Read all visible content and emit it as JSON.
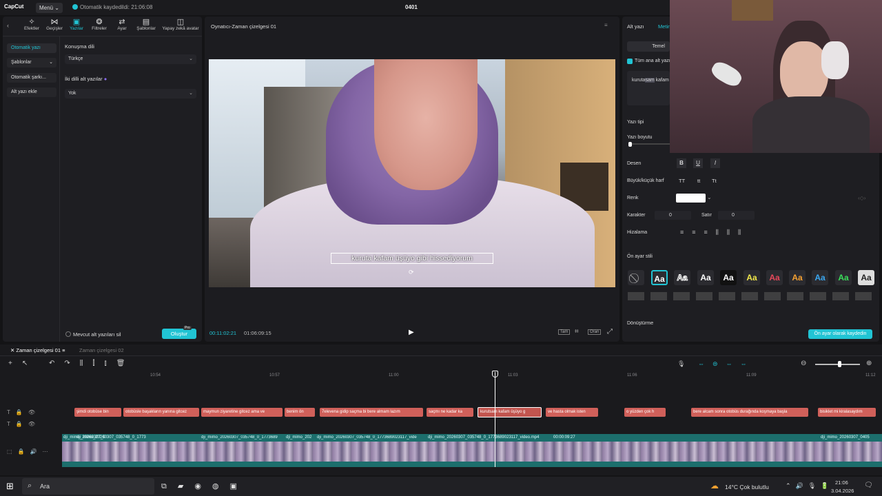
{
  "app": {
    "logo": "CapCut",
    "menu": "Menü",
    "autosave": "Otomatik kaydedildi: 21:06:08",
    "project_title": "0401"
  },
  "toolbar": [
    {
      "label": "Efektler",
      "icon": "effects-icon"
    },
    {
      "label": "Geçişler",
      "icon": "transitions-icon"
    },
    {
      "label": "Yazılar",
      "icon": "text-icon"
    },
    {
      "label": "Filtreler",
      "icon": "filters-icon"
    },
    {
      "label": "Ayar",
      "icon": "adjust-icon"
    },
    {
      "label": "Şablonlar",
      "icon": "templates-icon"
    },
    {
      "label": "Yapay zekâ avatar",
      "icon": "ai-avatar-icon"
    }
  ],
  "sidebar": {
    "items": [
      "Otomatik yazı",
      "Şablonlar",
      "Otomatik şarkı...",
      "Alt yazı ekle"
    ]
  },
  "captions_panel": {
    "speech_language_label": "Konuşma dili",
    "speech_language_value": "Türkçe",
    "bilingual_label": "İki dilli alt yazılar",
    "bilingual_value": "Yok",
    "delete_existing": "Mevcut alt yazıları sil",
    "create_button": "Oluştur",
    "pro_badge": "Pro"
  },
  "player": {
    "title": "Oynatıcı-Zaman çizelgesi 01",
    "subtitle_text": "kuruta kafam üşüyo gibi hissediyorum",
    "current_time": "00:11:02:21",
    "total_time": "01:06:09:15",
    "full_label": "Tam",
    "ratio_label": "Oran"
  },
  "right_panel": {
    "tab_caption": "Alt yazı",
    "tab_text": "Metin",
    "basic_tab": "Temel",
    "all_main_captions": "Tüm ana alt yazı",
    "text_snippet": "kuruta",
    "text_highlight": "sam",
    "text_rest": "kafam",
    "font_label": "Yazı tipi",
    "font_size_label": "Yazı boyutu",
    "pattern_label": "Desen",
    "case_label": "Büyük/küçük harf",
    "case_options": [
      "TT",
      "tt",
      "Tt"
    ],
    "color_label": "Renk",
    "char_label": "Karakter",
    "char_value": "0",
    "line_label": "Satır",
    "line_value": "0",
    "align_label": "Hizalama",
    "preset_label": "Ön ayar stili",
    "preset_aa": "Aa",
    "transform_label": "Dönüştürme",
    "save_preset": "Ön ayar olarak kaydedin",
    "colors": {
      "accent": "#21c4d4"
    }
  },
  "timeline": {
    "tab1": "Zaman çizelgesi 01",
    "tab2": "Zaman çizelgesi 02",
    "ticks": [
      "10:54",
      "10:57",
      "11:00",
      "11:03",
      "11:06",
      "11:09",
      "11:12"
    ],
    "clips": [
      "şimdi otobüse bin",
      "otobüsle başakların yanına gitcez",
      "maymun ziyaretine gitcez ama ve",
      "benim ön",
      "7elevena gidip saçma bi bere almam lazım",
      "saçmı ne kadar ka",
      "kurutsam kafam üşüyo g",
      "ve hasta olmak isten",
      "o yüzden çok h",
      "bere alcam sonra otobüs durağında koşmaya başla",
      "bisiklet mi kiralasaydım"
    ],
    "video_labels": [
      "dji_mimo_20260307_0",
      "dji_mimo_20260307_035748_0_1773",
      "dji_mimo_20260307_035748_0_1773689",
      "dji_mimo_202",
      "dji_mimo_20260307_035748_0_1773689023117_vide",
      "dji_mimo_20260307_035748_0_1773689023117_video.mp4",
      "00:00:09:27",
      "dji_mimo_20260307_0405"
    ]
  },
  "taskbar": {
    "search": "Ara",
    "weather": "14°C Çok bulutlu",
    "time": "21:06",
    "date": "3.04.2026"
  }
}
